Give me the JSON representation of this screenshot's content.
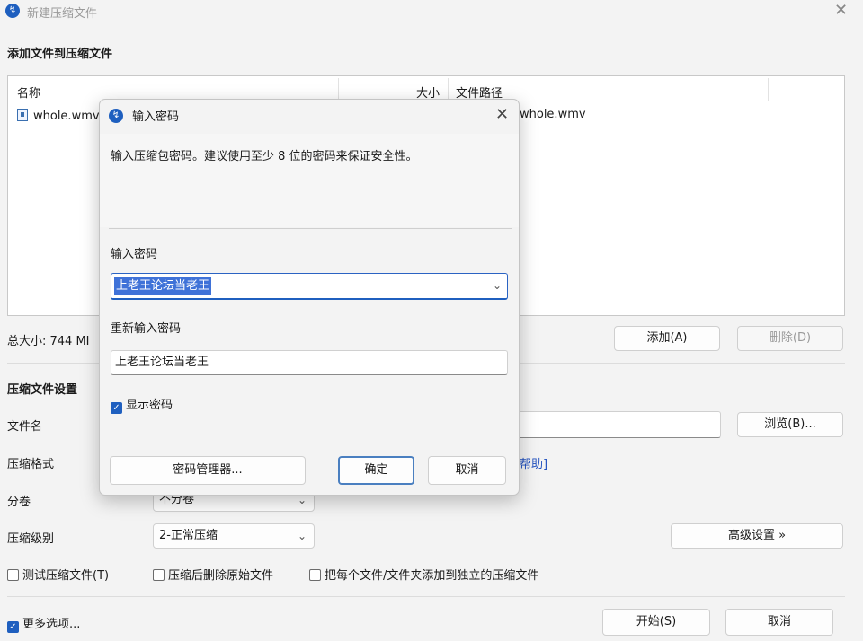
{
  "window": {
    "title": "新建压缩文件"
  },
  "add_section": {
    "title": "添加文件到压缩文件",
    "columns": [
      "名称",
      "大小",
      "文件路径"
    ],
    "rows": [
      {
        "name": "whole.wmv",
        "path": "whole.wmv"
      }
    ],
    "total_size": "总大小: 744 MI",
    "add_button": "添加(A)",
    "delete_button": "删除(D)"
  },
  "settings": {
    "title": "压缩文件设置",
    "filename_label": "文件名",
    "browse_button": "浏览(B)...",
    "format_label": "压缩格式",
    "help_link": "帮助]",
    "split_label": "分卷",
    "split_value": "不分卷",
    "level_label": "压缩级别",
    "level_value": "2-正常压缩",
    "advanced_button": "高级设置 »",
    "test_checkbox": "测试压缩文件(T)",
    "delete_after_checkbox": "压缩后删除原始文件",
    "separate_checkbox": "把每个文件/文件夹添加到独立的压缩文件"
  },
  "footer": {
    "more_options": "更多选项...",
    "start_button": "开始(S)",
    "cancel_button": "取消"
  },
  "dialog": {
    "title": "输入密码",
    "description": "输入压缩包密码。建议使用至少 8 位的密码来保证安全性。",
    "password_label": "输入密码",
    "password_value": "上老王论坛当老王",
    "reenter_label": "重新输入密码",
    "reenter_value": "上老王论坛当老王",
    "show_password": "显示密码",
    "manager_button": "密码管理器...",
    "ok_button": "确定",
    "cancel_button": "取消"
  },
  "colors": {
    "accent": "#1f5fbf",
    "selection": "#3f72d8"
  }
}
